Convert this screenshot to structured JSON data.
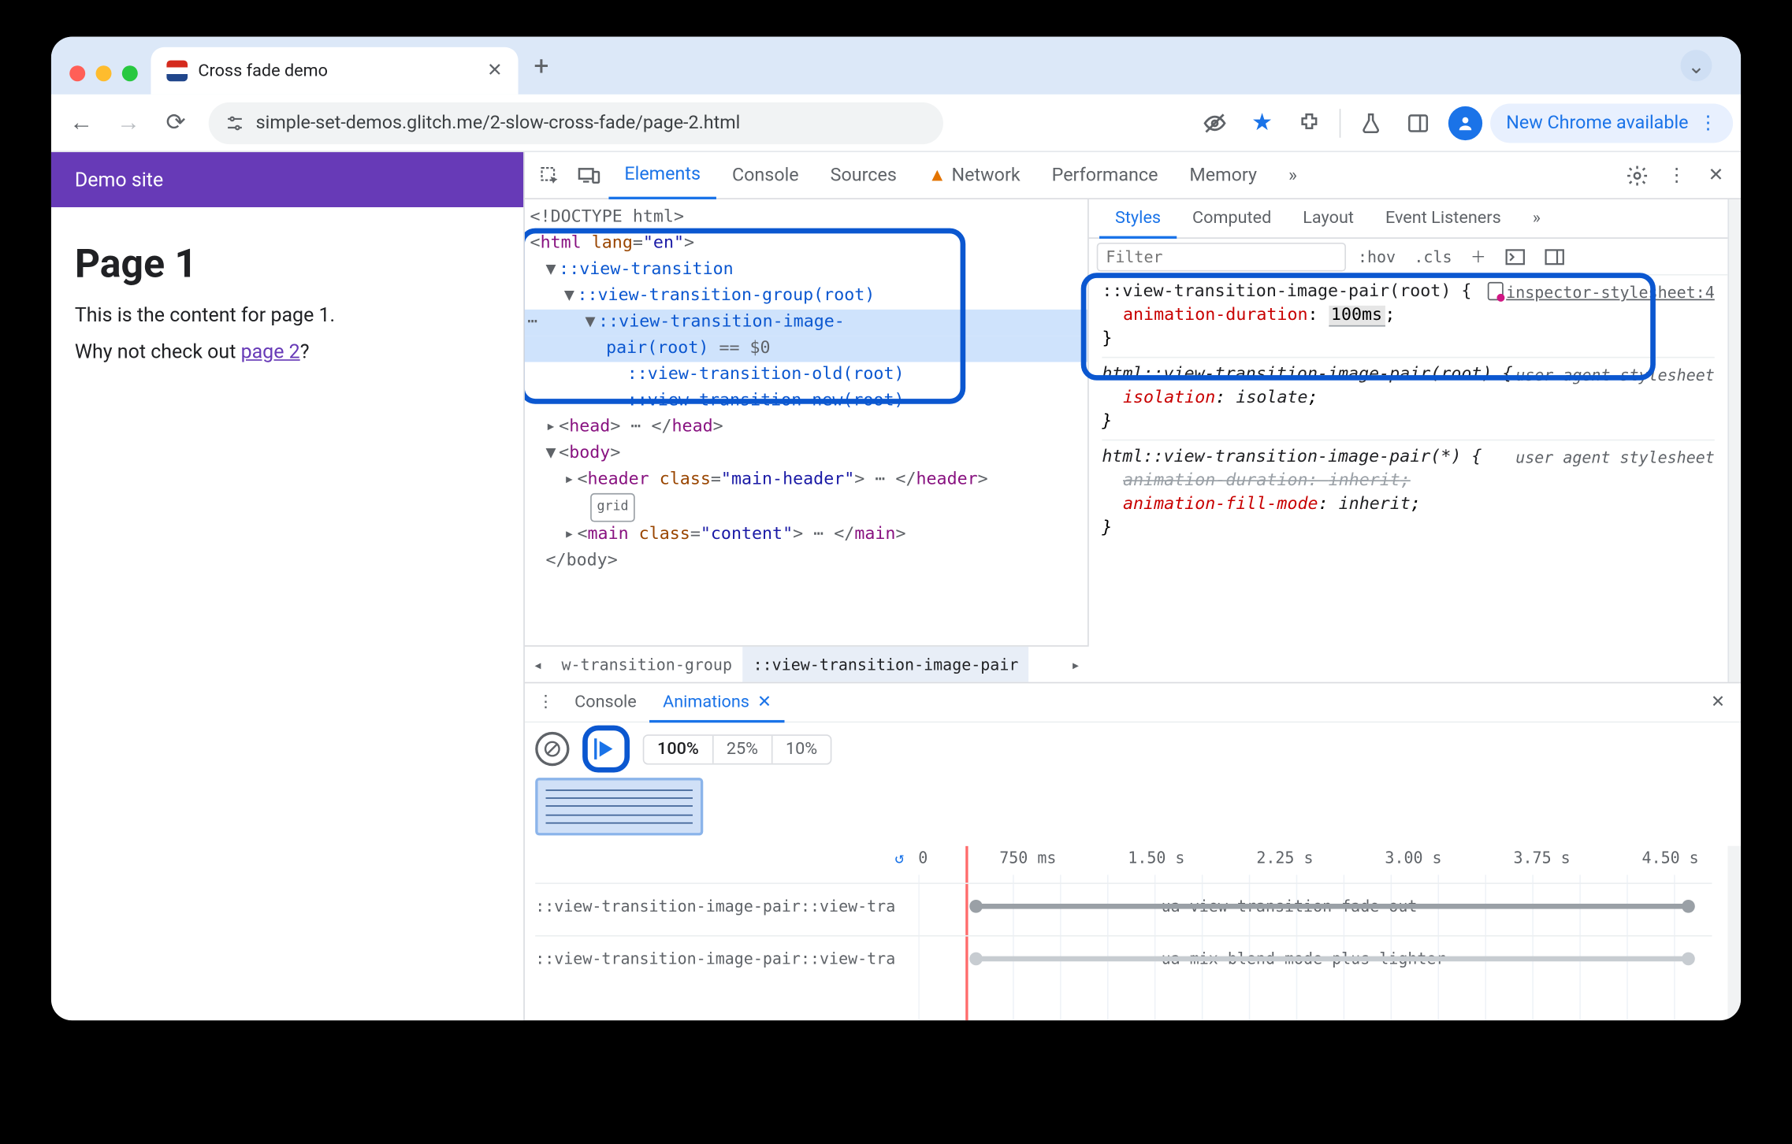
{
  "browser": {
    "tab_title": "Cross fade demo",
    "url": "simple-set-demos.glitch.me/2-slow-cross-fade/page-2.html",
    "update_chip": "New Chrome available"
  },
  "page": {
    "site_name": "Demo site",
    "heading": "Page 1",
    "body_text": "This is the content for page 1.",
    "link_intro": "Why not check out ",
    "link_text": "page 2",
    "link_suffix": "?"
  },
  "devtools": {
    "tabs": {
      "elements": "Elements",
      "console": "Console",
      "sources": "Sources",
      "network": "Network",
      "performance": "Performance",
      "memory": "Memory"
    },
    "tree": {
      "doctype": "<!DOCTYPE html>",
      "html_open": "html",
      "html_lang_attr": "lang",
      "html_lang_val": "\"en\"",
      "vt": "::view-transition",
      "vtg": "::view-transition-group(root)",
      "vtip": "::view-transition-image-",
      "vtip2": "pair(root)",
      "eq0": " == $0",
      "vto": "::view-transition-old(root)",
      "vtn": "::view-transition-new(root)",
      "head": "head",
      "body": "body",
      "header": "header",
      "header_class_attr": "class",
      "header_class_val": "\"main-header\"",
      "grid_badge": "grid",
      "main": "main",
      "main_class_val": "\"content\"",
      "body_close": "</body>"
    },
    "crumbs": {
      "prev": "w-transition-group",
      "curr": "::view-transition-image-pair"
    },
    "styles": {
      "tabs": {
        "styles": "Styles",
        "computed": "Computed",
        "layout": "Layout",
        "events": "Event Listeners"
      },
      "filter_placeholder": "Filter",
      "hov": ":hov",
      "cls": ".cls",
      "rule1": {
        "selector": "::view-transition-image-pair(root) {",
        "src": "inspector-stylesheet:4",
        "prop": "animation-duration",
        "val": "100ms",
        "close": "}"
      },
      "rule2": {
        "selector": "html::view-transition-image-pair(root) {",
        "src": "user agent stylesheet",
        "prop": "isolation",
        "val": "isolate",
        "close": "}"
      },
      "rule3": {
        "selector": "html::view-transition-image-pair(*) {",
        "src": "user agent stylesheet",
        "prop1": "animation-duration",
        "val1": "inherit",
        "prop2": "animation-fill-mode",
        "val2": "inherit",
        "close": "}"
      }
    },
    "drawer": {
      "console": "Console",
      "animations": "Animations",
      "speeds": {
        "s100": "100%",
        "s25": "25%",
        "s10": "10%"
      },
      "ticks": {
        "t0": "0",
        "t1": "750 ms",
        "t2": "1.50 s",
        "t3": "2.25 s",
        "t4": "3.00 s",
        "t5": "3.75 s",
        "t6": "4.50 s"
      },
      "row_label": "::view-transition-image-pair::view-tra",
      "anim1": "-ua-view-transition-fade-out",
      "anim2": "-ua-mix-blend-mode-plus-lighter"
    }
  }
}
